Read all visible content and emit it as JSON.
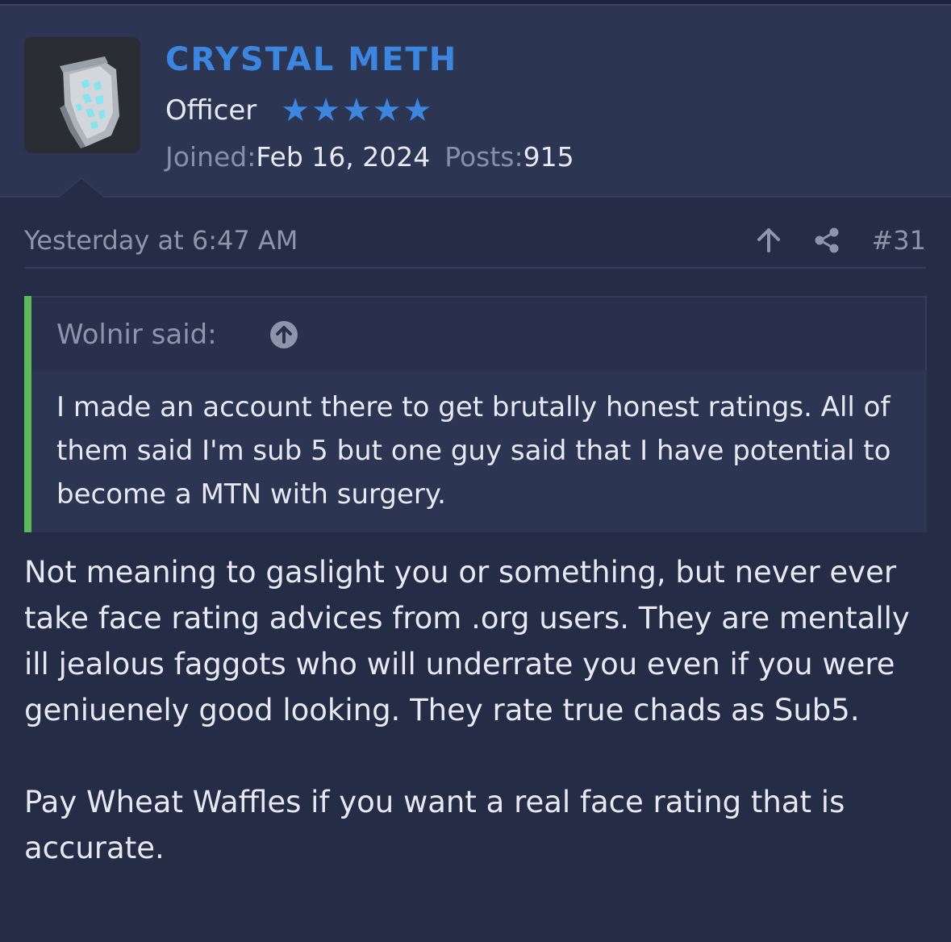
{
  "user": {
    "name": "CRYSTAL METH",
    "title": "Officer",
    "star_count": 5,
    "joined_label": "Joined:",
    "joined_value": "Feb 16, 2024",
    "posts_label": "Posts:",
    "posts_value": "915",
    "avatar_icon": "crystal-bag-avatar"
  },
  "post": {
    "timestamp": "Yesterday at 6:47 AM",
    "number": "#31",
    "actions": [
      "up-arrow-icon",
      "share-icon"
    ]
  },
  "quote": {
    "author": "Wolnir said:",
    "body": "I made an account there to get brutally honest ratings. All of them said I'm sub 5 but one guy said that I have potential to become a MTN with surgery."
  },
  "message": {
    "paragraphs": [
      "Not meaning to gaslight you or something, but never ever take face rating advices from .org users. They are mentally ill jealous faggots who will underrate you even if you were geniuenely good looking. They rate true chads as Sub5.",
      "Pay Wheat Waffles if you want a real face rating that is accurate."
    ]
  },
  "colors": {
    "background": "#252c45",
    "header": "#2c3552",
    "accent": "#3d86e0",
    "quote_bar": "#5cb85c",
    "muted_text": "#8d95ad",
    "text": "#e6e9f2"
  }
}
